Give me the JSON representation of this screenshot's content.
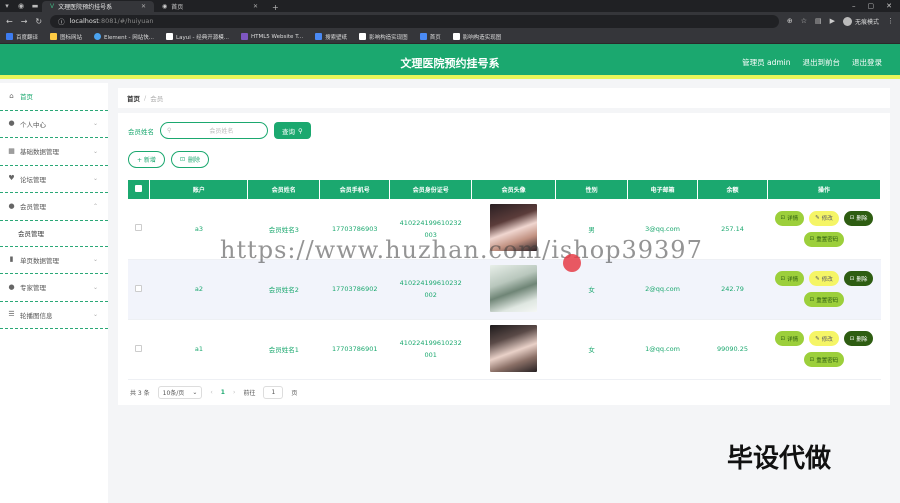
{
  "browser": {
    "tabs": [
      {
        "label": "文理医院预约挂号系",
        "active": true
      },
      {
        "label": "首页",
        "active": false
      }
    ],
    "url_host": "localhost",
    "url_rest": ":8081/#/huiyuan",
    "profile": "无痕模式",
    "bookmarks": [
      "百度翻译",
      "图标网站",
      "Element - 网站快...",
      "Layui - 经典开源模...",
      "HTML5 Website T...",
      "搜索壁纸",
      "影响构造实现图",
      "首页",
      "影响构造实现图"
    ]
  },
  "header": {
    "title": "文理医院预约挂号系",
    "user": "管理员 admin",
    "exit_front": "退出到前台",
    "logout": "退出登录"
  },
  "sidebar": {
    "items": [
      {
        "label": "首页",
        "icon": "home-icon"
      },
      {
        "label": "个人中心",
        "icon": "user-icon"
      },
      {
        "label": "基础数据管理",
        "icon": "grid-icon"
      },
      {
        "label": "论坛管理",
        "icon": "chat-icon"
      },
      {
        "label": "会员管理",
        "icon": "user-icon"
      },
      {
        "label": "单页数据管理",
        "icon": "chart-icon"
      },
      {
        "label": "专家管理",
        "icon": "user-icon"
      },
      {
        "label": "轮播图信息",
        "icon": "list-icon"
      }
    ],
    "sub_item": "会员管理"
  },
  "breadcrumb": {
    "home": "首页",
    "sep": "/",
    "current": "会员"
  },
  "search": {
    "label": "会员姓名",
    "placeholder": "会员姓名",
    "button": "查询"
  },
  "actions": {
    "add": "+ 新增",
    "delete": "删除"
  },
  "table": {
    "headers": [
      "账户",
      "会员姓名",
      "会员手机号",
      "会员身份证号",
      "会员头像",
      "性别",
      "电子邮箱",
      "余额",
      "操作"
    ],
    "rows": [
      {
        "account": "a3",
        "name": "会员姓名3",
        "phone": "17703786903",
        "id_a": "410224199610232",
        "id_b": "003",
        "gender": "男",
        "email": "3@qq.com",
        "balance": "257.14"
      },
      {
        "account": "a2",
        "name": "会员姓名2",
        "phone": "17703786902",
        "id_a": "410224199610232",
        "id_b": "002",
        "gender": "女",
        "email": "2@qq.com",
        "balance": "242.79"
      },
      {
        "account": "a1",
        "name": "会员姓名1",
        "phone": "17703786901",
        "id_a": "410224199610232",
        "id_b": "001",
        "gender": "女",
        "email": "1@qq.com",
        "balance": "99090.25"
      }
    ],
    "ops": {
      "detail": "详情",
      "edit": "修改",
      "del": "删除",
      "reset": "重置密码"
    }
  },
  "pager": {
    "total": "共 3 条",
    "size": "10条/页",
    "page": "1",
    "goto": "前往",
    "goto_val": "1",
    "page_unit": "页"
  },
  "overlay": {
    "watermark": "https://www.huzhan.com/ishop39397",
    "badge": "毕设代做"
  }
}
